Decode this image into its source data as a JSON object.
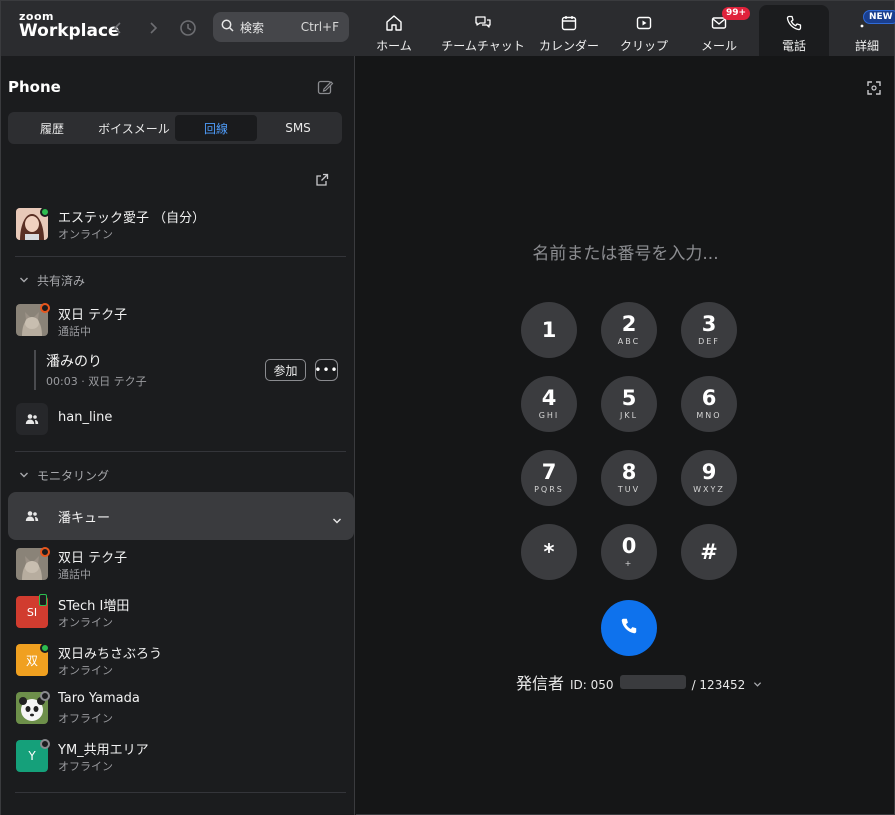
{
  "app": {
    "logo_top": "zoom",
    "logo_bottom": "Workplace"
  },
  "search": {
    "label": "検索",
    "shortcut": "Ctrl+F"
  },
  "tabs": [
    {
      "label": "ホーム",
      "icon": "home-icon"
    },
    {
      "label": "チームチャット",
      "icon": "chat-icon"
    },
    {
      "label": "カレンダー",
      "icon": "calendar-icon"
    },
    {
      "label": "クリップ",
      "icon": "clip-icon"
    },
    {
      "label": "メール",
      "icon": "mail-icon",
      "badge": "99+"
    },
    {
      "label": "電話",
      "icon": "phone-icon",
      "active": true
    },
    {
      "label": "詳細",
      "icon": "more-icon",
      "badge": "NEW"
    }
  ],
  "phone": {
    "title": "Phone",
    "segments": [
      "履歴",
      "ボイスメール",
      "回線",
      "SMS"
    ],
    "active_segment": "回線",
    "self": {
      "name": "エステック愛子 （自分）",
      "status": "オンライン"
    },
    "shared": {
      "heading": "共有済み",
      "user": {
        "name": "双日 テク子",
        "status": "通話中"
      },
      "call": {
        "name": "潘みのり",
        "detail": "00:03 · 双日 テク子",
        "join": "参加",
        "more": "•••"
      },
      "group": {
        "name": "han_line"
      }
    },
    "monitoring": {
      "heading": "モニタリング",
      "group": {
        "name": "潘キュー"
      },
      "members": [
        {
          "name": "双日 テク子",
          "status": "通話中",
          "avatar": "cat"
        },
        {
          "name": "STech I増田",
          "status": "オンライン",
          "initials": "SI",
          "color": "#d13c2f"
        },
        {
          "name": "双日みちさぶろう",
          "status": "オンライン",
          "initials": "双",
          "color": "#f0a020"
        },
        {
          "name": "Taro Yamada",
          "status": "オフライン",
          "avatar": "panda"
        },
        {
          "name": "YM_共用エリア",
          "status": "オフライン",
          "initials": "Y",
          "color": "#15a07a"
        }
      ]
    }
  },
  "dialer": {
    "placeholder": "名前または番号を入力...",
    "keys": [
      {
        "d": "1",
        "l": ""
      },
      {
        "d": "2",
        "l": "ABC"
      },
      {
        "d": "3",
        "l": "DEF"
      },
      {
        "d": "4",
        "l": "GHI"
      },
      {
        "d": "5",
        "l": "JKL"
      },
      {
        "d": "6",
        "l": "MNO"
      },
      {
        "d": "7",
        "l": "PQRS"
      },
      {
        "d": "8",
        "l": "TUV"
      },
      {
        "d": "9",
        "l": "WXYZ"
      },
      {
        "d": "*",
        "l": ""
      },
      {
        "d": "0",
        "l": "+"
      },
      {
        "d": "#",
        "l": ""
      }
    ],
    "caller_label": "発信者",
    "caller_id_prefix": "ID: 050",
    "caller_ext": "/ 123452"
  },
  "colors": {
    "accent": "#0e72ed",
    "active_tab_text": "#4f9cf9",
    "online": "#2dbd4f",
    "busy": "#e8561c",
    "badge": "#e0223b"
  }
}
